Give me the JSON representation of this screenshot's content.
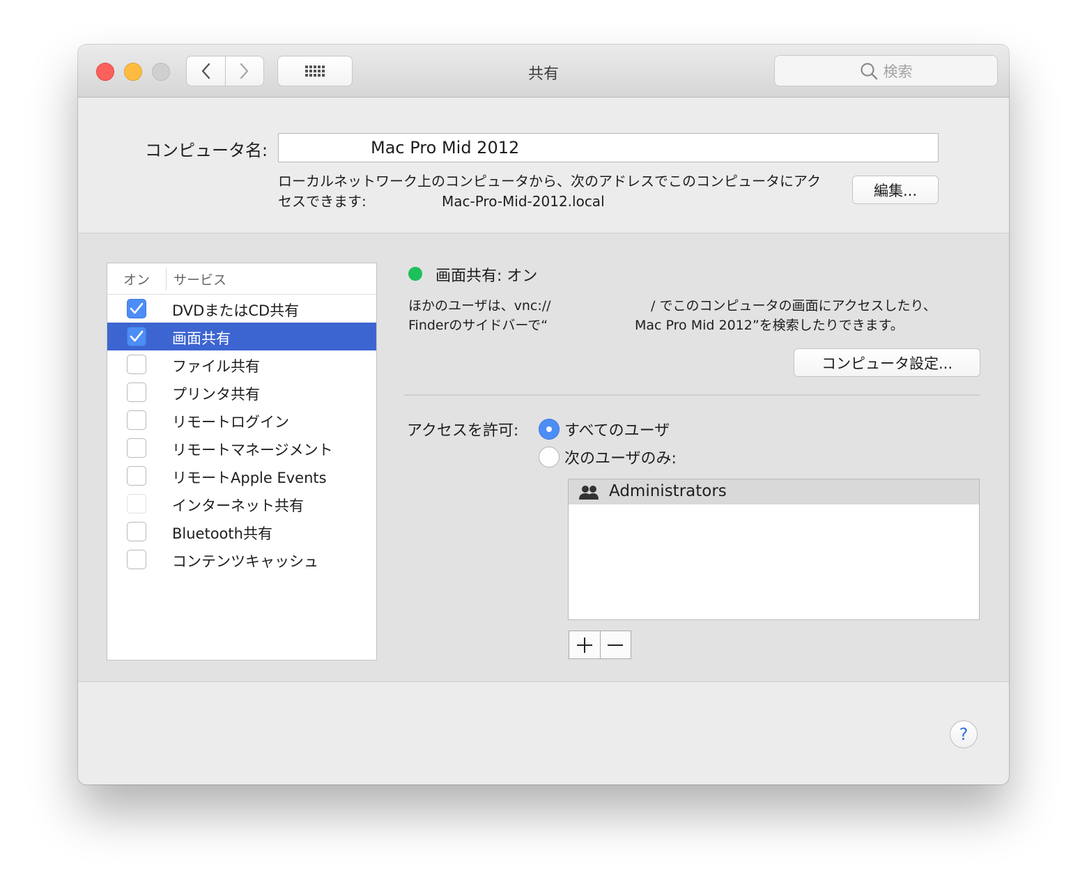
{
  "window": {
    "title": "共有"
  },
  "toolbar": {
    "back_icon": "chevron-left-icon",
    "forward_icon": "chevron-right-icon",
    "grid_icon": "grid-icon",
    "search_placeholder": "検索"
  },
  "computer": {
    "name_label": "コンピュータ名:",
    "name_value": "Mac Pro Mid 2012",
    "address_desc_line1": "ローカルネットワーク上のコンピュータから、次のアドレスでこのコンピュータにアク",
    "address_desc_line2": "セスできます:",
    "address": "Mac-Pro-Mid-2012.local",
    "edit_button": "編集..."
  },
  "services": {
    "col_on": "オン",
    "col_service": "サービス",
    "items": [
      {
        "label": "DVDまたはCD共有",
        "checked": true,
        "selected": false,
        "enabled": true
      },
      {
        "label": "画面共有",
        "checked": true,
        "selected": true,
        "enabled": true
      },
      {
        "label": "ファイル共有",
        "checked": false,
        "selected": false,
        "enabled": true
      },
      {
        "label": "プリンタ共有",
        "checked": false,
        "selected": false,
        "enabled": true
      },
      {
        "label": "リモートログイン",
        "checked": false,
        "selected": false,
        "enabled": true
      },
      {
        "label": "リモートマネージメント",
        "checked": false,
        "selected": false,
        "enabled": true
      },
      {
        "label": "リモートApple Events",
        "checked": false,
        "selected": false,
        "enabled": true
      },
      {
        "label": "インターネット共有",
        "checked": false,
        "selected": false,
        "enabled": false
      },
      {
        "label": "Bluetooth共有",
        "checked": false,
        "selected": false,
        "enabled": true
      },
      {
        "label": "コンテンツキャッシュ",
        "checked": false,
        "selected": false,
        "enabled": true
      }
    ]
  },
  "detail": {
    "status_title": "画面共有: オン",
    "status_color": "#1dc05a",
    "desc_line1_a": "ほかのユーザは、vnc://",
    "desc_line1_b": "/ でこのコンピュータの画面にアクセスしたり、",
    "desc_line2_a": "Finderのサイドバーで“",
    "desc_line2_b": "Mac Pro Mid 2012”を検索したりできます。",
    "computer_settings_button": "コンピュータ設定...",
    "access_label": "アクセスを許可:",
    "radio_all": "すべてのユーザ",
    "radio_only": "次のユーザのみ:",
    "users": [
      "Administrators"
    ],
    "add_label": "+",
    "remove_label": "−"
  },
  "help_label": "?",
  "colors": {
    "accent": "#3d65d1",
    "checkbox": "#4c8df6"
  }
}
